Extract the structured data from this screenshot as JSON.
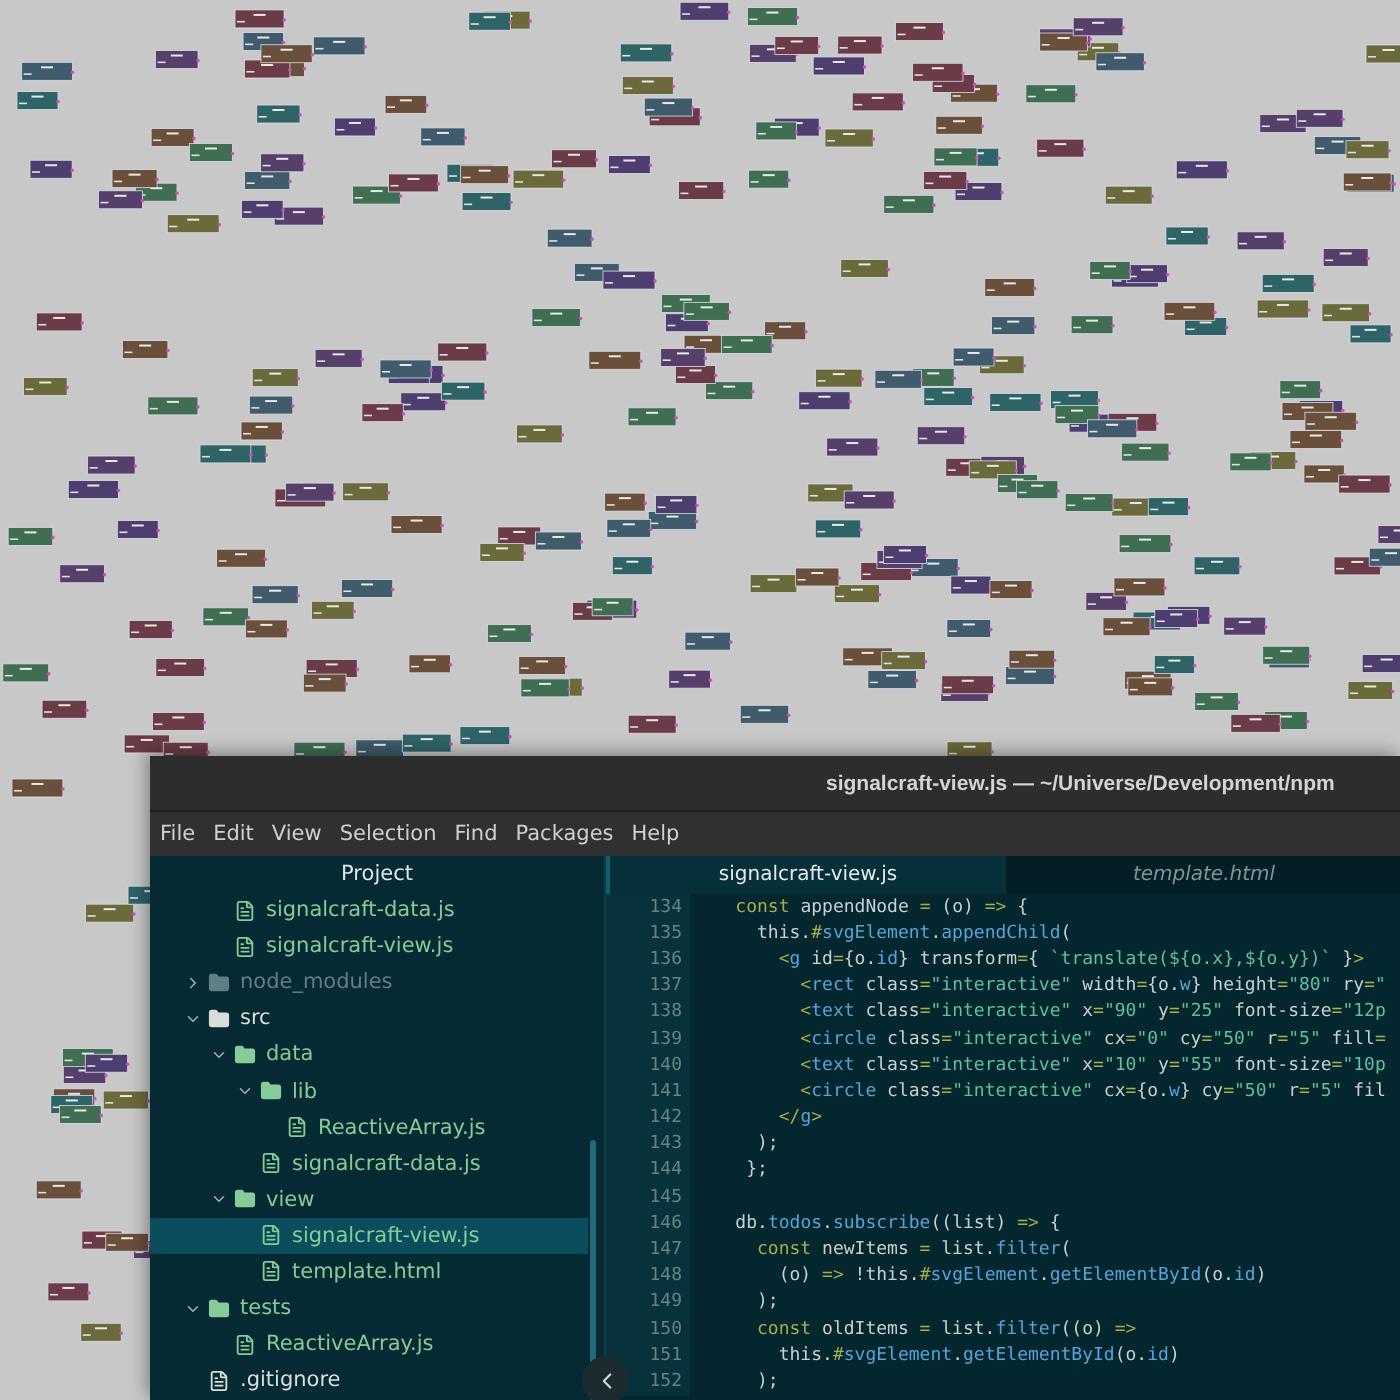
{
  "window": {
    "title": "signalcraft-view.js — ~/Universe/Development/npm"
  },
  "menu": [
    "File",
    "Edit",
    "View",
    "Selection",
    "Find",
    "Packages",
    "Help"
  ],
  "tree": {
    "header": "Project",
    "scrolled_group": [
      {
        "name": "signalcraft-data.js",
        "kind": "file",
        "color": "#86cc96",
        "selected": false
      },
      {
        "name": "signalcraft-view.js",
        "kind": "file",
        "color": "#86cc96",
        "selected": false
      }
    ],
    "items": [
      {
        "name": "node_modules",
        "kind": "folder",
        "color": "#5f7e85",
        "expanded": false,
        "selected": false
      },
      {
        "name": "src",
        "kind": "folder",
        "color": "#d9dfd8",
        "expanded": true,
        "selected": false,
        "children": [
          {
            "name": "data",
            "kind": "folder",
            "color": "#86cc96",
            "expanded": true,
            "selected": false,
            "children": [
              {
                "name": "lib",
                "kind": "folder",
                "color": "#86cc96",
                "expanded": true,
                "selected": false,
                "children": [
                  {
                    "name": "ReactiveArray.js",
                    "kind": "file",
                    "color": "#86cc96",
                    "selected": false
                  }
                ]
              },
              {
                "name": "signalcraft-data.js",
                "kind": "file",
                "color": "#86cc96",
                "selected": false
              }
            ]
          },
          {
            "name": "view",
            "kind": "folder",
            "color": "#86cc96",
            "expanded": true,
            "selected": false,
            "children": [
              {
                "name": "signalcraft-view.js",
                "kind": "file",
                "color": "#86cc96",
                "selected": true
              },
              {
                "name": "template.html",
                "kind": "file",
                "color": "#86cc96",
                "selected": false
              }
            ]
          }
        ]
      },
      {
        "name": "tests",
        "kind": "folder",
        "color": "#86cc96",
        "expanded": true,
        "selected": false,
        "children": [
          {
            "name": "ReactiveArray.js",
            "kind": "file",
            "color": "#86cc96",
            "selected": false
          }
        ]
      },
      {
        "name": ".gitignore",
        "kind": "file",
        "color": "#d9dfd8",
        "selected": false
      }
    ]
  },
  "tabs": [
    {
      "label": "signalcraft-view.js",
      "selected": true
    },
    {
      "label": "template.html",
      "selected": false
    }
  ],
  "code": [
    {
      "number": "134",
      "tokens": [
        {
          "kind": "kw",
          "text": "    const"
        },
        {
          "kind": "p",
          "text": " appendNode "
        },
        {
          "kind": "kw",
          "text": "="
        },
        {
          "kind": "p",
          "text": " (o) "
        },
        {
          "kind": "kw",
          "text": "=>"
        },
        {
          "kind": "p",
          "text": " {"
        }
      ]
    },
    {
      "number": "135",
      "tokens": [
        {
          "kind": "p",
          "text": "      this."
        },
        {
          "kind": "kw",
          "text": "#"
        },
        {
          "kind": "fn",
          "text": "svgElement"
        },
        {
          "kind": "p",
          "text": "."
        },
        {
          "kind": "fn",
          "text": "appendChild"
        },
        {
          "kind": "p",
          "text": "("
        }
      ]
    },
    {
      "number": "136",
      "tokens": [
        {
          "kind": "kw",
          "text": "        <"
        },
        {
          "kind": "fn",
          "text": "g"
        },
        {
          "kind": "p",
          "text": " id"
        },
        {
          "kind": "kw",
          "text": "="
        },
        {
          "kind": "p",
          "text": "{o."
        },
        {
          "kind": "fn",
          "text": "id"
        },
        {
          "kind": "p",
          "text": "} transform"
        },
        {
          "kind": "kw",
          "text": "="
        },
        {
          "kind": "p",
          "text": "{ "
        },
        {
          "kind": "str",
          "text": "`translate(${o.x},${o.y})`"
        },
        {
          "kind": "p",
          "text": " }"
        },
        {
          "kind": "kw",
          "text": ">"
        }
      ]
    },
    {
      "number": "137",
      "tokens": [
        {
          "kind": "kw",
          "text": "          <"
        },
        {
          "kind": "fn",
          "text": "rect"
        },
        {
          "kind": "p",
          "text": " class"
        },
        {
          "kind": "kw",
          "text": "="
        },
        {
          "kind": "str",
          "text": "\"interactive\""
        },
        {
          "kind": "p",
          "text": " width"
        },
        {
          "kind": "kw",
          "text": "="
        },
        {
          "kind": "p",
          "text": "{o."
        },
        {
          "kind": "fn",
          "text": "w"
        },
        {
          "kind": "p",
          "text": "} height"
        },
        {
          "kind": "kw",
          "text": "="
        },
        {
          "kind": "str",
          "text": "\"80\""
        },
        {
          "kind": "p",
          "text": " ry"
        },
        {
          "kind": "kw",
          "text": "="
        },
        {
          "kind": "str",
          "text": "\""
        }
      ]
    },
    {
      "number": "138",
      "tokens": [
        {
          "kind": "kw",
          "text": "          <"
        },
        {
          "kind": "fn",
          "text": "text"
        },
        {
          "kind": "p",
          "text": " class"
        },
        {
          "kind": "kw",
          "text": "="
        },
        {
          "kind": "str",
          "text": "\"interactive\""
        },
        {
          "kind": "p",
          "text": " x"
        },
        {
          "kind": "kw",
          "text": "="
        },
        {
          "kind": "str",
          "text": "\"90\""
        },
        {
          "kind": "p",
          "text": " y"
        },
        {
          "kind": "kw",
          "text": "="
        },
        {
          "kind": "str",
          "text": "\"25\""
        },
        {
          "kind": "p",
          "text": " font-size"
        },
        {
          "kind": "kw",
          "text": "="
        },
        {
          "kind": "str",
          "text": "\"12p"
        }
      ]
    },
    {
      "number": "139",
      "tokens": [
        {
          "kind": "kw",
          "text": "          <"
        },
        {
          "kind": "fn",
          "text": "circle"
        },
        {
          "kind": "p",
          "text": " class"
        },
        {
          "kind": "kw",
          "text": "="
        },
        {
          "kind": "str",
          "text": "\"interactive\""
        },
        {
          "kind": "p",
          "text": " cx"
        },
        {
          "kind": "kw",
          "text": "="
        },
        {
          "kind": "str",
          "text": "\"0\""
        },
        {
          "kind": "p",
          "text": " cy"
        },
        {
          "kind": "kw",
          "text": "="
        },
        {
          "kind": "str",
          "text": "\"50\""
        },
        {
          "kind": "p",
          "text": " r"
        },
        {
          "kind": "kw",
          "text": "="
        },
        {
          "kind": "str",
          "text": "\"5\""
        },
        {
          "kind": "p",
          "text": " fill"
        },
        {
          "kind": "kw",
          "text": "="
        }
      ]
    },
    {
      "number": "140",
      "tokens": [
        {
          "kind": "kw",
          "text": "          <"
        },
        {
          "kind": "fn",
          "text": "text"
        },
        {
          "kind": "p",
          "text": " class"
        },
        {
          "kind": "kw",
          "text": "="
        },
        {
          "kind": "str",
          "text": "\"interactive\""
        },
        {
          "kind": "p",
          "text": " x"
        },
        {
          "kind": "kw",
          "text": "="
        },
        {
          "kind": "str",
          "text": "\"10\""
        },
        {
          "kind": "p",
          "text": " y"
        },
        {
          "kind": "kw",
          "text": "="
        },
        {
          "kind": "str",
          "text": "\"55\""
        },
        {
          "kind": "p",
          "text": " font-size"
        },
        {
          "kind": "kw",
          "text": "="
        },
        {
          "kind": "str",
          "text": "\"10p"
        }
      ]
    },
    {
      "number": "141",
      "tokens": [
        {
          "kind": "kw",
          "text": "          <"
        },
        {
          "kind": "fn",
          "text": "circle"
        },
        {
          "kind": "p",
          "text": " class"
        },
        {
          "kind": "kw",
          "text": "="
        },
        {
          "kind": "str",
          "text": "\"interactive\""
        },
        {
          "kind": "p",
          "text": " cx"
        },
        {
          "kind": "kw",
          "text": "="
        },
        {
          "kind": "p",
          "text": "{o."
        },
        {
          "kind": "fn",
          "text": "w"
        },
        {
          "kind": "p",
          "text": "} cy"
        },
        {
          "kind": "kw",
          "text": "="
        },
        {
          "kind": "str",
          "text": "\"50\""
        },
        {
          "kind": "p",
          "text": " r"
        },
        {
          "kind": "kw",
          "text": "="
        },
        {
          "kind": "str",
          "text": "\"5\""
        },
        {
          "kind": "p",
          "text": " fil"
        }
      ]
    },
    {
      "number": "142",
      "tokens": [
        {
          "kind": "kw",
          "text": "        </"
        },
        {
          "kind": "fn",
          "text": "g"
        },
        {
          "kind": "kw",
          "text": ">"
        }
      ]
    },
    {
      "number": "143",
      "tokens": [
        {
          "kind": "p",
          "text": "      );"
        }
      ]
    },
    {
      "number": "144",
      "tokens": [
        {
          "kind": "p",
          "text": "     };"
        }
      ]
    },
    {
      "number": "145"
    },
    {
      "number": "146",
      "tokens": [
        {
          "kind": "p",
          "text": "    db."
        },
        {
          "kind": "fn",
          "text": "todos"
        },
        {
          "kind": "p",
          "text": "."
        },
        {
          "kind": "fn",
          "text": "subscribe"
        },
        {
          "kind": "p",
          "text": "((list) "
        },
        {
          "kind": "kw",
          "text": "=>"
        },
        {
          "kind": "p",
          "text": " {"
        }
      ]
    },
    {
      "number": "147",
      "tokens": [
        {
          "kind": "kw",
          "text": "      const"
        },
        {
          "kind": "p",
          "text": " newItems "
        },
        {
          "kind": "kw",
          "text": "="
        },
        {
          "kind": "p",
          "text": " list."
        },
        {
          "kind": "fn",
          "text": "filter"
        },
        {
          "kind": "p",
          "text": "("
        }
      ]
    },
    {
      "number": "148",
      "tokens": [
        {
          "kind": "p",
          "text": "        (o) "
        },
        {
          "kind": "kw",
          "text": "=>"
        },
        {
          "kind": "p",
          "text": " !this."
        },
        {
          "kind": "kw",
          "text": "#"
        },
        {
          "kind": "fn",
          "text": "svgElement"
        },
        {
          "kind": "p",
          "text": "."
        },
        {
          "kind": "fn",
          "text": "getElementById"
        },
        {
          "kind": "p",
          "text": "(o."
        },
        {
          "kind": "fn",
          "text": "id"
        },
        {
          "kind": "p",
          "text": ")"
        }
      ]
    },
    {
      "number": "149",
      "tokens": [
        {
          "kind": "p",
          "text": "      );"
        }
      ]
    },
    {
      "number": "150",
      "tokens": [
        {
          "kind": "kw",
          "text": "      const"
        },
        {
          "kind": "p",
          "text": " oldItems "
        },
        {
          "kind": "kw",
          "text": "="
        },
        {
          "kind": "p",
          "text": " list."
        },
        {
          "kind": "fn",
          "text": "filter"
        },
        {
          "kind": "p",
          "text": "((o) "
        },
        {
          "kind": "kw",
          "text": "=>"
        }
      ]
    },
    {
      "number": "151",
      "tokens": [
        {
          "kind": "p",
          "text": "        this."
        },
        {
          "kind": "kw",
          "text": "#"
        },
        {
          "kind": "fn",
          "text": "svgElement"
        },
        {
          "kind": "p",
          "text": "."
        },
        {
          "kind": "fn",
          "text": "getElementById"
        },
        {
          "kind": "p",
          "text": "(o."
        },
        {
          "kind": "fn",
          "text": "id"
        },
        {
          "kind": "p",
          "text": ")"
        }
      ]
    },
    {
      "number": "152",
      "tokens": [
        {
          "kind": "p",
          "text": "      );"
        }
      ]
    }
  ]
}
